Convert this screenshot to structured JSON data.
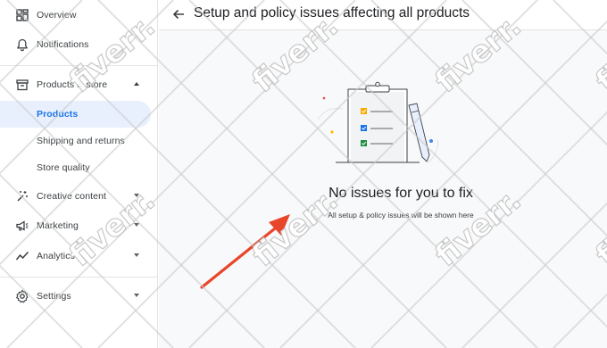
{
  "sidebar": {
    "items": [
      {
        "label": "Overview",
        "icon": "overview-icon"
      },
      {
        "label": "Notifications",
        "icon": "bell-icon"
      },
      {
        "label": "Products & store",
        "icon": "store-icon",
        "expanded": true
      },
      {
        "label": "Products",
        "active": true
      },
      {
        "label": "Shipping and returns"
      },
      {
        "label": "Store quality"
      },
      {
        "label": "Creative content",
        "icon": "creative-icon"
      },
      {
        "label": "Marketing",
        "icon": "megaphone-icon"
      },
      {
        "label": "Analytics",
        "icon": "analytics-icon"
      },
      {
        "label": "Settings",
        "icon": "gear-icon"
      }
    ]
  },
  "header": {
    "title": "Setup and policy issues affecting all products"
  },
  "empty_state": {
    "title": "No issues for you to fix",
    "subtitle": "All setup & policy issues will be shown here"
  },
  "colors": {
    "accent": "#1a73e8",
    "active_bg": "#e8f0fe",
    "annotation_arrow": "#e8462a",
    "check_yellow": "#f9ab00",
    "check_blue": "#1a73e8",
    "check_green": "#1e8e3e"
  },
  "watermark_text": "fiverr."
}
